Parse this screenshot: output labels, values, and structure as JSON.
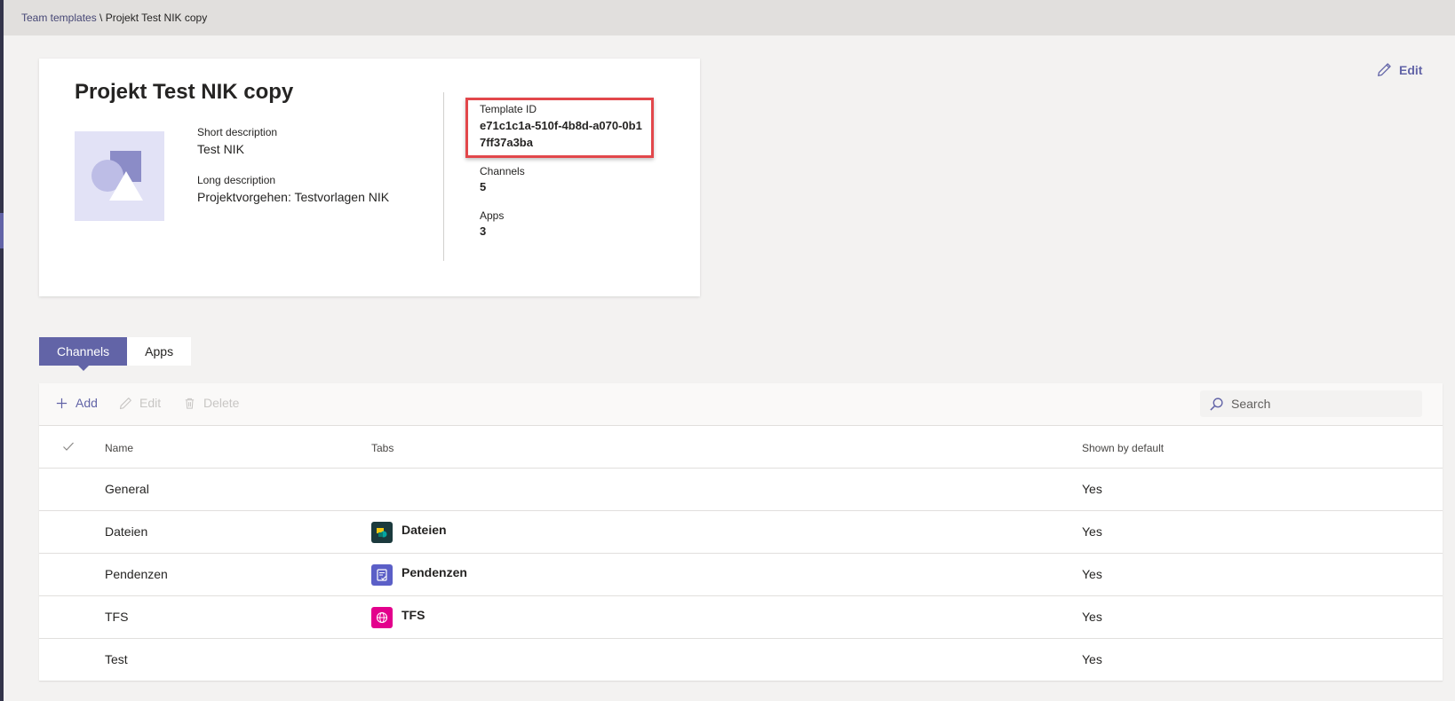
{
  "breadcrumb": {
    "parent": "Team templates",
    "separator": " \\ ",
    "current": "Projekt Test NIK copy"
  },
  "header": {
    "edit_label": "Edit"
  },
  "template": {
    "title": "Projekt Test NIK copy",
    "short_description_label": "Short description",
    "short_description": "Test NIK",
    "long_description_label": "Long description",
    "long_description": "Projektvorgehen: Testvorlagen NIK",
    "template_id_label": "Template ID",
    "template_id": "e71c1c1a-510f-4b8d-a070-0b17ff37a3ba",
    "channels_label": "Channels",
    "channels_count": "5",
    "apps_label": "Apps",
    "apps_count": "3"
  },
  "tabs": [
    {
      "label": "Channels",
      "active": true
    },
    {
      "label": "Apps",
      "active": false
    }
  ],
  "toolbar": {
    "add_label": "Add",
    "edit_label": "Edit",
    "delete_label": "Delete",
    "search_placeholder": "Search"
  },
  "table": {
    "columns": {
      "name": "Name",
      "tabs": "Tabs",
      "shown_by_default": "Shown by default"
    },
    "rows": [
      {
        "name": "General",
        "tab": "",
        "tab_icon": "",
        "shown": "Yes"
      },
      {
        "name": "Dateien",
        "tab": "Dateien",
        "tab_icon": "sharepoint-files-icon",
        "shown": "Yes"
      },
      {
        "name": "Pendenzen",
        "tab": "Pendenzen",
        "tab_icon": "tasks-icon",
        "shown": "Yes"
      },
      {
        "name": "TFS",
        "tab": "TFS",
        "tab_icon": "website-globe-icon",
        "shown": "Yes"
      },
      {
        "name": "Test",
        "tab": "",
        "tab_icon": "",
        "shown": "Yes"
      }
    ]
  },
  "colors": {
    "accent": "#6264a7",
    "highlight_border": "#e2474b",
    "files_icon_bg": "#1b3a3d",
    "tasks_icon_bg": "#5b5fc7",
    "globe_icon_bg": "#e3008c"
  }
}
